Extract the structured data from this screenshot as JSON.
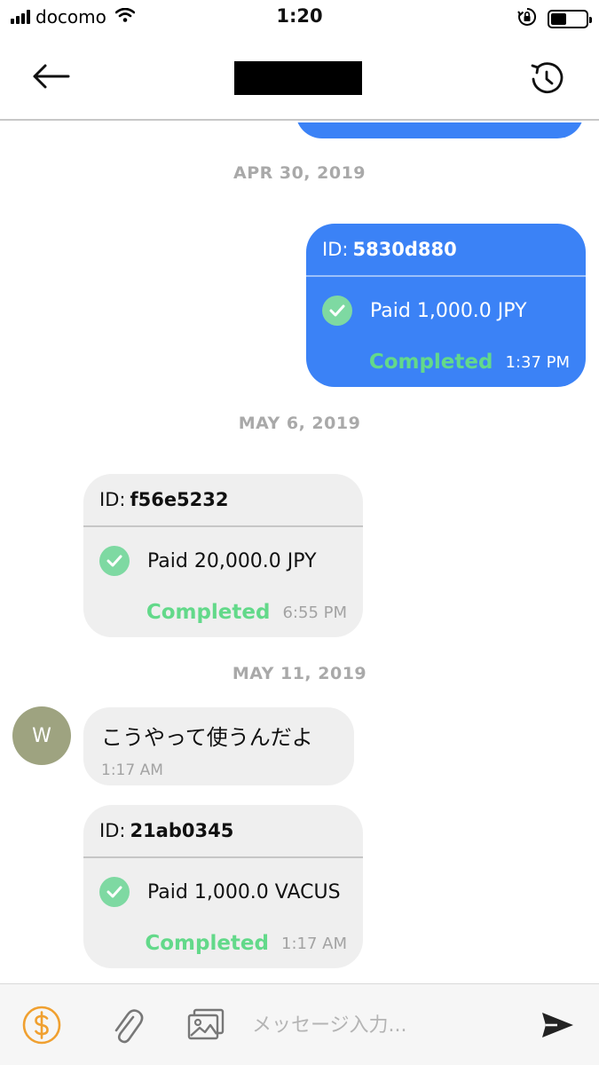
{
  "status_bar": {
    "carrier": "docomo",
    "time": "1:20"
  },
  "header": {
    "title_redacted": true
  },
  "dates": {
    "d1": "APR 30, 2019",
    "d2": "MAY 6, 2019",
    "d3": "MAY 11, 2019"
  },
  "payments": [
    {
      "id_label": "ID:",
      "id_value": "5830d880",
      "amount_text": "Paid 1,000.0 JPY",
      "status": "Completed",
      "time": "1:37 PM",
      "side": "mine"
    },
    {
      "id_label": "ID:",
      "id_value": "f56e5232",
      "amount_text": "Paid 20,000.0 JPY",
      "status": "Completed",
      "time": "6:55 PM",
      "side": "theirs"
    },
    {
      "id_label": "ID:",
      "id_value": "21ab0345",
      "amount_text": "Paid 1,000.0 VACUS",
      "status": "Completed",
      "time": "1:17 AM",
      "side": "theirs"
    }
  ],
  "text_message": {
    "avatar_initial": "W",
    "text": "こうやって使うんだよ",
    "time": "1:17 AM"
  },
  "input_bar": {
    "placeholder": "メッセージ入力..."
  },
  "colors": {
    "mine_bubble": "#3b82f6",
    "theirs_bubble": "#efefef",
    "completed_green": "#63d98a",
    "check_green": "#7ed9a2",
    "dollar_orange": "#f0a030",
    "avatar_bg": "#9ea380"
  },
  "icons": [
    "signal-icon",
    "wifi-icon",
    "orientation-lock-icon",
    "battery-icon",
    "back-arrow-icon",
    "history-icon",
    "check-icon",
    "dollar-icon",
    "paperclip-icon",
    "image-icon",
    "send-icon"
  ]
}
